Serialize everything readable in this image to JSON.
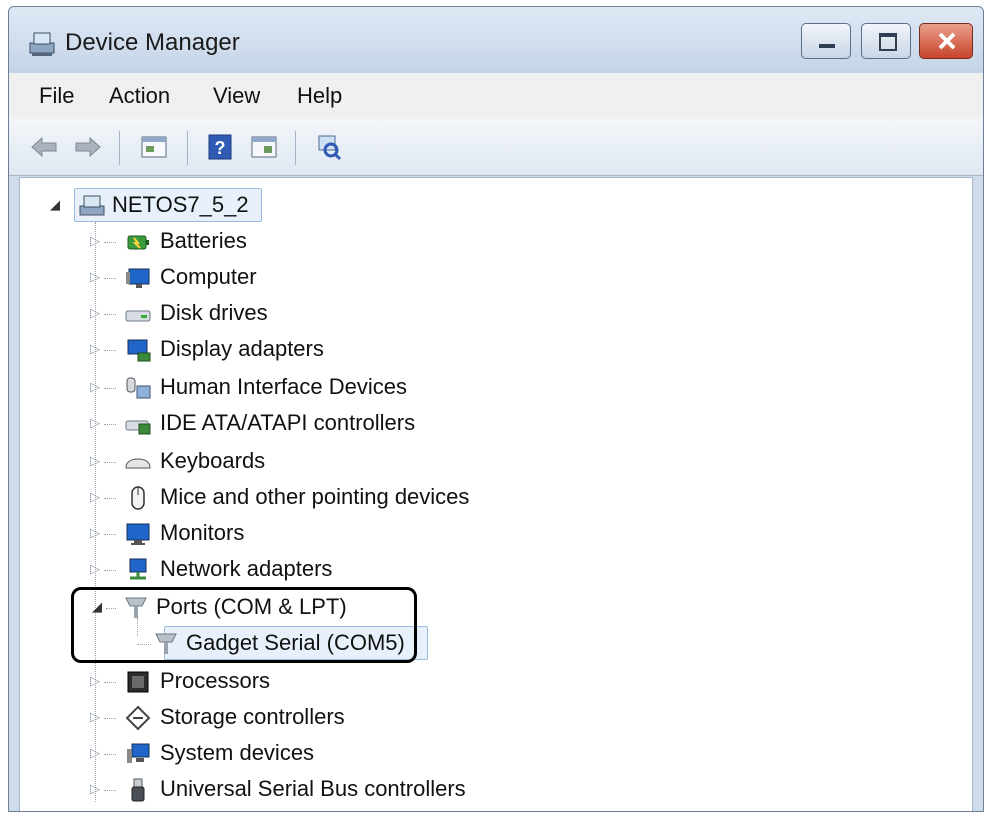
{
  "window": {
    "title": "Device Manager",
    "controls": {
      "minimize": "minimize",
      "maximize": "maximize",
      "close": "close"
    }
  },
  "menu": [
    "File",
    "Action",
    "View",
    "Help"
  ],
  "toolbar": {
    "icons": [
      "back-arrow-icon",
      "forward-arrow-icon",
      "properties-icon",
      "help-icon",
      "show-hide-console-icon",
      "scan-hardware-icon"
    ]
  },
  "tree": {
    "root": {
      "label": "NETOS7_5_2",
      "icon": "computer-icon"
    },
    "items": [
      {
        "label": "Batteries",
        "icon": "battery-icon",
        "expanded": false
      },
      {
        "label": "Computer",
        "icon": "monitor-icon",
        "expanded": false
      },
      {
        "label": "Disk drives",
        "icon": "disk-drive-icon",
        "expanded": false
      },
      {
        "label": "Display adapters",
        "icon": "display-adapter-icon",
        "expanded": false
      },
      {
        "label": "Human Interface Devices",
        "icon": "hid-icon",
        "expanded": false
      },
      {
        "label": "IDE ATA/ATAPI controllers",
        "icon": "ide-controller-icon",
        "expanded": false
      },
      {
        "label": "Keyboards",
        "icon": "keyboard-icon",
        "expanded": false
      },
      {
        "label": "Mice and other pointing devices",
        "icon": "mouse-icon",
        "expanded": false
      },
      {
        "label": "Monitors",
        "icon": "monitor-icon",
        "expanded": false
      },
      {
        "label": "Network adapters",
        "icon": "network-adapter-icon",
        "expanded": false
      },
      {
        "label": "Ports (COM & LPT)",
        "icon": "port-icon",
        "expanded": true,
        "children": [
          {
            "label": "Gadget Serial (COM5)",
            "icon": "port-icon"
          }
        ]
      },
      {
        "label": "Processors",
        "icon": "processor-icon",
        "expanded": false
      },
      {
        "label": "Storage controllers",
        "icon": "storage-controller-icon",
        "expanded": false
      },
      {
        "label": "System devices",
        "icon": "system-device-icon",
        "expanded": false
      },
      {
        "label": "Universal Serial Bus controllers",
        "icon": "usb-icon",
        "expanded": false
      }
    ]
  }
}
